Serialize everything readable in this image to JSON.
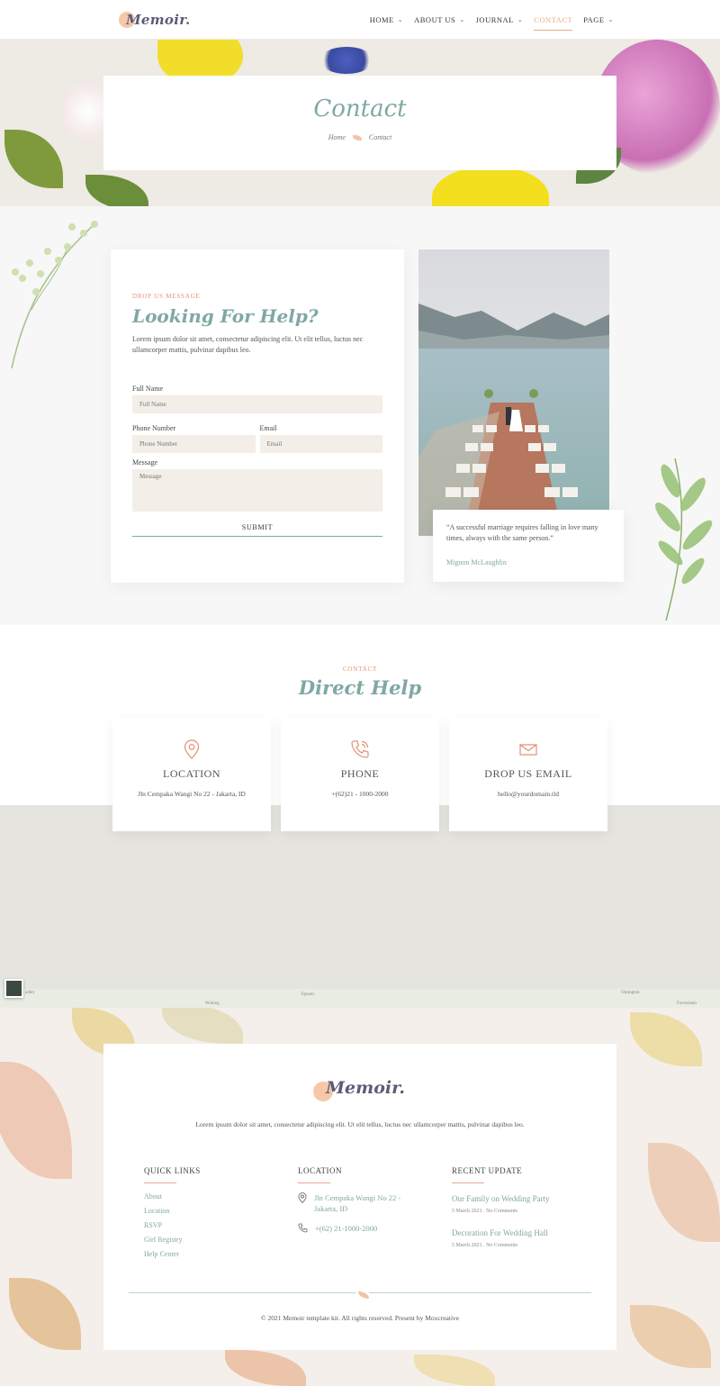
{
  "header": {
    "logo": "Memoir.",
    "nav": [
      {
        "label": "HOME",
        "has_menu": true,
        "active": false
      },
      {
        "label": "ABOUT US",
        "has_menu": true,
        "active": false
      },
      {
        "label": "JOURNAL",
        "has_menu": true,
        "active": false
      },
      {
        "label": "CONTACT",
        "has_menu": false,
        "active": true
      },
      {
        "label": "PAGE",
        "has_menu": true,
        "active": false
      }
    ]
  },
  "hero": {
    "title": "Contact",
    "breadcrumb": {
      "home": "Home",
      "current": "Contact"
    }
  },
  "form": {
    "eyebrow": "DROP US MESSAGE",
    "heading": "Looking For Help?",
    "lead": "Lorem ipsum dolor sit amet, consectetur adipiscing elit. Ut elit tellus, luctus nec ullamcorper mattis, pulvinar dapibus leo.",
    "full_name": {
      "label": "Full Name",
      "placeholder": "Full Name"
    },
    "phone": {
      "label": "Phone Number",
      "placeholder": "Phone Number"
    },
    "email": {
      "label": "Email",
      "placeholder": "Email"
    },
    "message": {
      "label": "Message",
      "placeholder": "Message"
    },
    "submit": "SUBMIT"
  },
  "quote": {
    "text": "“A successful marriage requires falling in love many times, always with the same person.”",
    "author": "Mignon McLaughlin"
  },
  "help": {
    "eyebrow": "CONTACT",
    "heading": "Direct Help",
    "cards": [
      {
        "icon": "map-pin-icon",
        "title": "LOCATION",
        "text": "Jln Cempaka Wangi No 22 - Jakarta, ID"
      },
      {
        "icon": "phone-icon",
        "title": "PHONE",
        "text": "+(62)21 - 1000-2000"
      },
      {
        "icon": "envelope-icon",
        "title": "DROP US EMAIL",
        "text": "hello@yourdomain.tld"
      }
    ]
  },
  "map": {
    "labels": [
      "adley",
      "Woking",
      "Epsom",
      "Orpington",
      "Faversham"
    ]
  },
  "footer": {
    "logo": "Memoir.",
    "lead": "Lorem ipsum dolor sit amet, consectetur adipiscing elit. Ut elit tellus, luctus nec ullamcorper mattis, pulvinar dapibus leo.",
    "quick_links": {
      "title": "QUICK LINKS",
      "items": [
        "About",
        "Location",
        "RSVP",
        "Girf Registry",
        "Help Center"
      ]
    },
    "location": {
      "title": "LOCATION",
      "address": "Jln Cempaka Wangi No 22 - Jakarta, ID",
      "phone": "+(62) 21-1000-2000"
    },
    "recent": {
      "title": "RECENT UPDATE",
      "posts": [
        {
          "title": "Our Family on Wedding Party",
          "meta": "5 March 2021 . No Comments"
        },
        {
          "title": "Decoration For Wedding Hall",
          "meta": "5 March 2021 . No Comments"
        }
      ]
    },
    "copyright": "© 2021 Memoir template kit. All rights reserved. Present by Moxcreative"
  },
  "colors": {
    "accent": "#7fa8a4",
    "peach": "#e9a98a",
    "cream": "#f3efe8"
  }
}
